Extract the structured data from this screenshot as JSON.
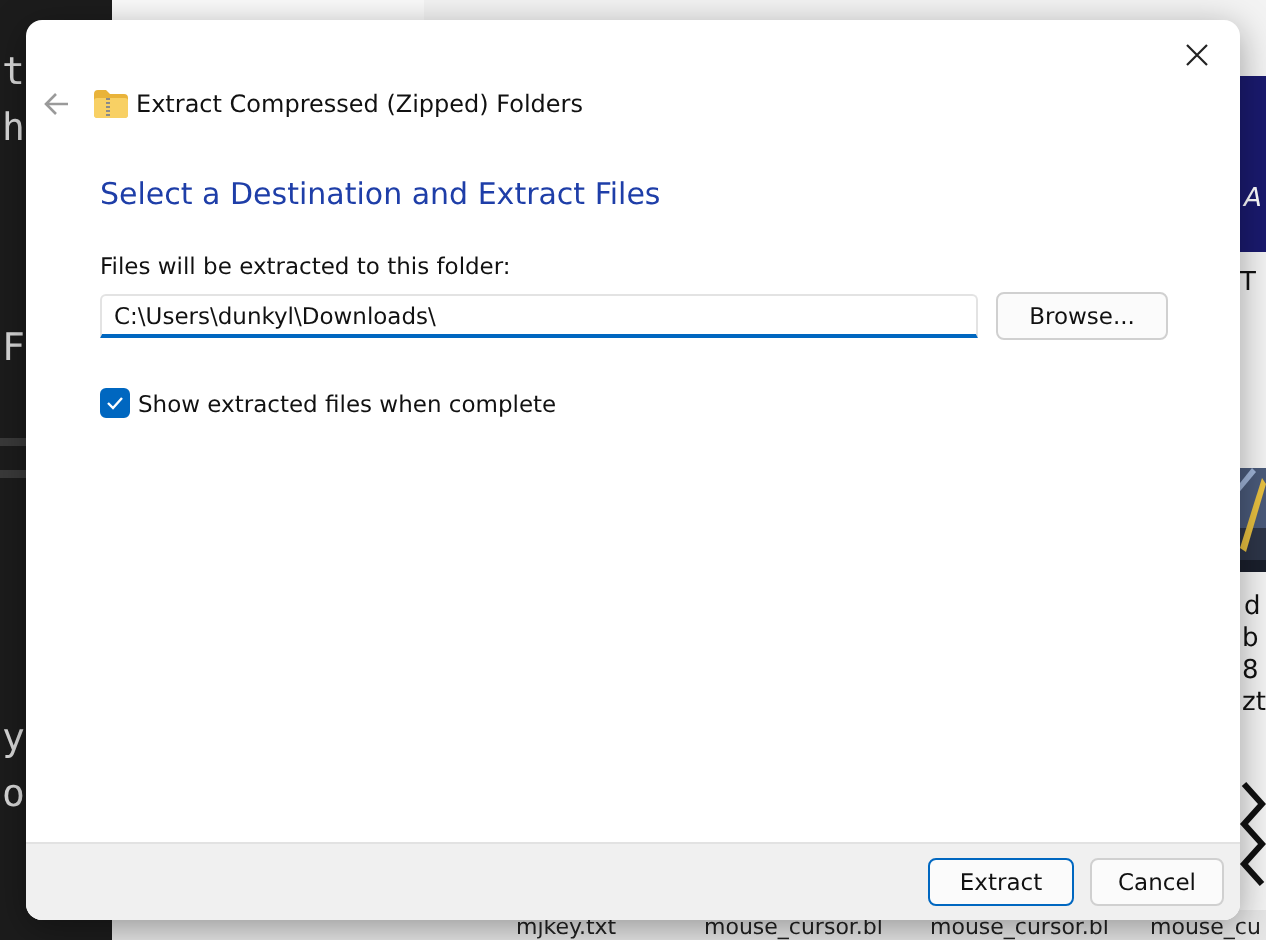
{
  "terminal": {
    "lines": [
      "t",
      "h",
      "F",
      "y",
      "o"
    ]
  },
  "background_window": {
    "texts": [
      "A",
      "T",
      "d",
      "b",
      "8",
      "zt"
    ],
    "files": [
      "mjkey.txt",
      "mouse_cursor.bl",
      "mouse_cursor.bl",
      "mouse_cu"
    ]
  },
  "dialog": {
    "title": "Extract Compressed (Zipped) Folders",
    "heading": "Select a Destination and Extract Files",
    "field_label": "Files will be extracted to this folder:",
    "path": {
      "value": "C:\\Users\\dunkyl\\Downloads\\"
    },
    "browse_button": "Browse...",
    "show_files": {
      "label": "Show extracted files when complete",
      "checked": true
    },
    "buttons": [
      {
        "label": "Extract",
        "default": true
      },
      {
        "label": "Cancel",
        "default": false
      }
    ]
  }
}
